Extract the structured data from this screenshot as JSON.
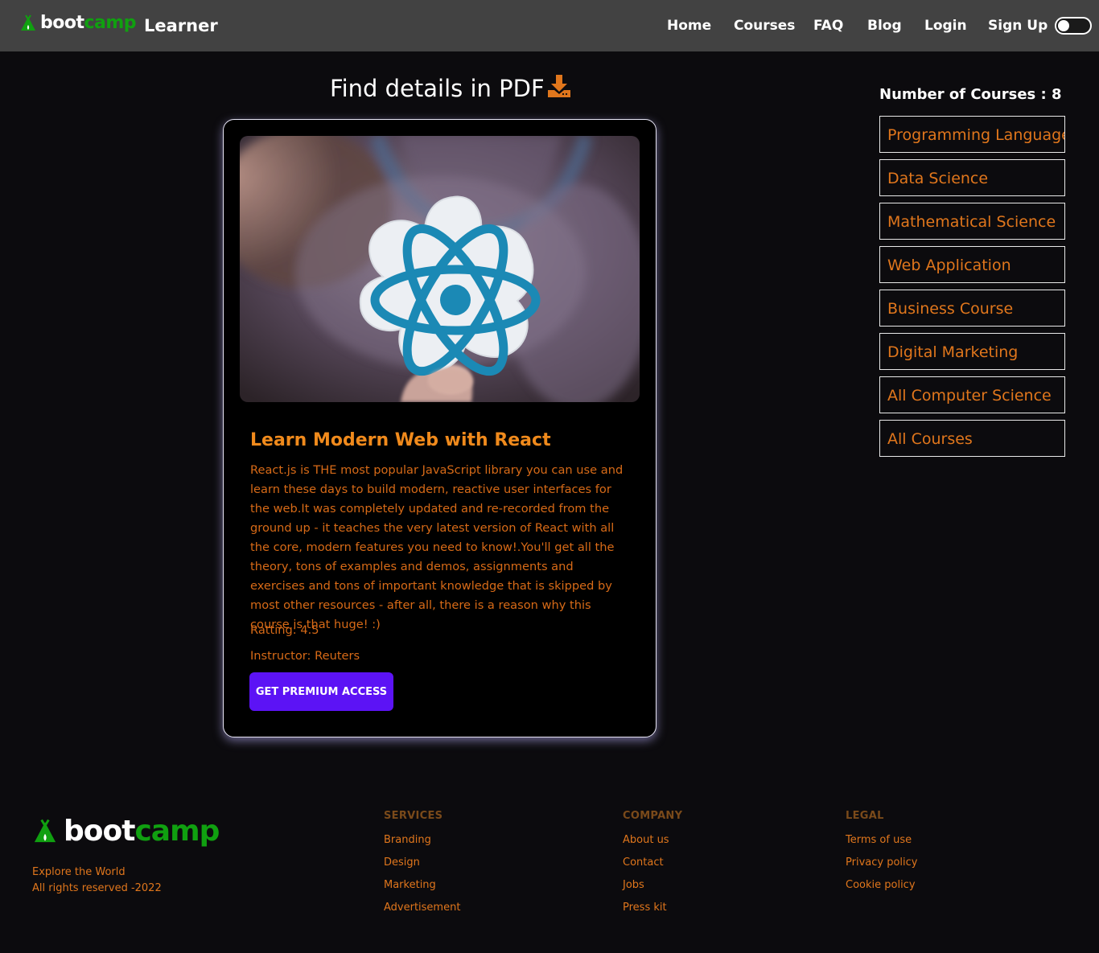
{
  "nav": {
    "logo": {
      "boot": "boot",
      "camp": "camp"
    },
    "brand": "Learner",
    "links": [
      "Home",
      "Courses",
      "FAQ",
      "Blog",
      "Login",
      "Sign Up"
    ],
    "theme_toggle": "off"
  },
  "main": {
    "pdf_heading": "Find details in PDF",
    "card": {
      "title": "Learn Modern Web with React",
      "description": "React.js is THE most popular JavaScript library you can use and learn these days to build modern, reactive user interfaces for the web.It was completely updated and re-recorded from the ground up - it teaches the very latest version of React with all the core, modern features you need to know!.You'll get all the theory, tons of examples and demos, assignments and exercises and tons of important knowledge that is skipped by most other resources - after all, there is a reason why this course is that huge! :)",
      "rating": "Ratting: 4.5",
      "instructor": "Instructor: Reuters",
      "cta": "GET PREMIUM ACCESS"
    }
  },
  "sidebar": {
    "count_label": "Number of Courses : 8",
    "categories": [
      "Programming Language",
      "Data Science",
      "Mathematical Science",
      "Web Application",
      "Business Course",
      "Digital Marketing",
      "All Computer Science",
      "All Courses"
    ]
  },
  "footer": {
    "logo": {
      "boot": "boot",
      "camp": "camp"
    },
    "tagline_1": "Explore the World",
    "tagline_2": "All rights reserved -2022",
    "services": {
      "heading": "SERVICES",
      "links": [
        "Branding",
        "Design",
        "Marketing",
        "Advertisement"
      ]
    },
    "company": {
      "heading": "COMPANY",
      "links": [
        "About us",
        "Contact",
        "Jobs",
        "Press kit"
      ]
    },
    "legal": {
      "heading": "LEGAL",
      "links": [
        "Terms of use",
        "Privacy policy",
        "Cookie policy"
      ]
    }
  },
  "colors": {
    "accent_orange": "#e0761c",
    "brand_green": "#10a010",
    "button_purple": "#5c13f5",
    "navbar_bg": "#424242"
  }
}
